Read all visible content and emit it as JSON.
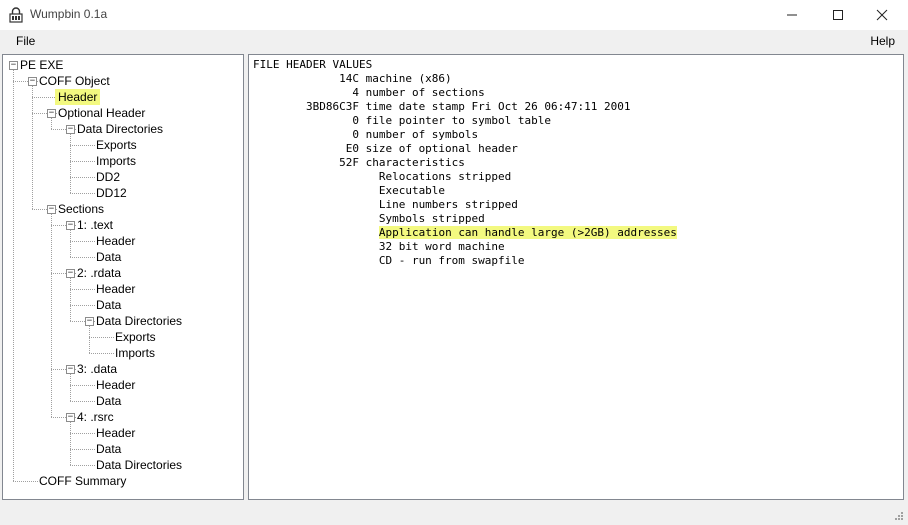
{
  "window": {
    "title": "Wumpbin 0.1a",
    "icon": "lock-icon"
  },
  "menu": {
    "file": "File",
    "help": "Help"
  },
  "tree": [
    {
      "label": "PE EXE",
      "depth": 0,
      "expander": "minus"
    },
    {
      "label": "COFF Object",
      "depth": 1,
      "expander": "minus"
    },
    {
      "label": "Header",
      "depth": 2,
      "expander": "none",
      "selected": true
    },
    {
      "label": "Optional Header",
      "depth": 2,
      "expander": "minus"
    },
    {
      "label": "Data Directories",
      "depth": 3,
      "expander": "minus"
    },
    {
      "label": "Exports",
      "depth": 4,
      "expander": "none"
    },
    {
      "label": "Imports",
      "depth": 4,
      "expander": "none"
    },
    {
      "label": "DD2",
      "depth": 4,
      "expander": "none"
    },
    {
      "label": "DD12",
      "depth": 4,
      "expander": "none"
    },
    {
      "label": "Sections",
      "depth": 2,
      "expander": "minus"
    },
    {
      "label": "1: .text",
      "depth": 3,
      "expander": "minus"
    },
    {
      "label": "Header",
      "depth": 4,
      "expander": "none"
    },
    {
      "label": "Data",
      "depth": 4,
      "expander": "none"
    },
    {
      "label": "2: .rdata",
      "depth": 3,
      "expander": "minus"
    },
    {
      "label": "Header",
      "depth": 4,
      "expander": "none"
    },
    {
      "label": "Data",
      "depth": 4,
      "expander": "none"
    },
    {
      "label": "Data Directories",
      "depth": 4,
      "expander": "minus"
    },
    {
      "label": "Exports",
      "depth": 5,
      "expander": "none"
    },
    {
      "label": "Imports",
      "depth": 5,
      "expander": "none"
    },
    {
      "label": "3: .data",
      "depth": 3,
      "expander": "minus"
    },
    {
      "label": "Header",
      "depth": 4,
      "expander": "none"
    },
    {
      "label": "Data",
      "depth": 4,
      "expander": "none"
    },
    {
      "label": "4: .rsrc",
      "depth": 3,
      "expander": "minus"
    },
    {
      "label": "Header",
      "depth": 4,
      "expander": "none"
    },
    {
      "label": "Data",
      "depth": 4,
      "expander": "none"
    },
    {
      "label": "Data Directories",
      "depth": 4,
      "expander": "none"
    },
    {
      "label": "COFF Summary",
      "depth": 1,
      "expander": "none"
    }
  ],
  "content": {
    "lines": [
      {
        "text": "FILE HEADER VALUES"
      },
      {
        "text": "             14C machine (x86)"
      },
      {
        "text": "               4 number of sections"
      },
      {
        "text": "        3BD86C3F time date stamp Fri Oct 26 06:47:11 2001"
      },
      {
        "text": "               0 file pointer to symbol table"
      },
      {
        "text": "               0 number of symbols"
      },
      {
        "text": "              E0 size of optional header"
      },
      {
        "text": "             52F characteristics"
      },
      {
        "text": "                   Relocations stripped"
      },
      {
        "text": "                   Executable"
      },
      {
        "text": "                   Line numbers stripped"
      },
      {
        "text": "                   Symbols stripped"
      },
      {
        "text": "                   Application can handle large (>2GB) addresses",
        "highlight": "Application can handle large (>2GB) addresses"
      },
      {
        "text": "                   32 bit word machine"
      },
      {
        "text": "                   CD - run from swapfile"
      }
    ]
  },
  "colors": {
    "highlight": "#f3f980",
    "pane_border": "#828790",
    "chrome_bg": "#f0f0f0"
  }
}
